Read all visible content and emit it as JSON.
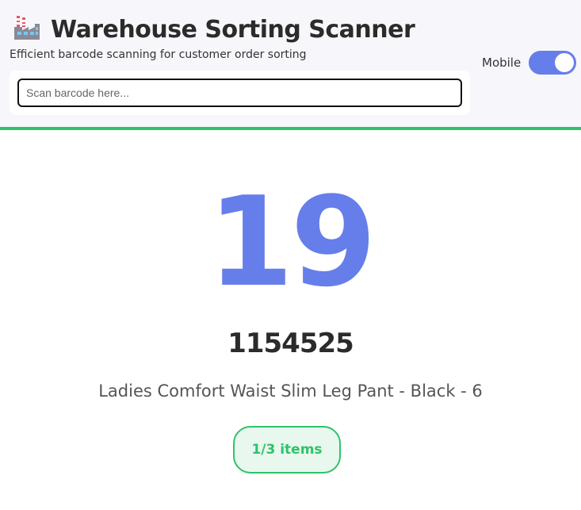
{
  "header": {
    "icon": "factory-icon",
    "title": "Warehouse Sorting Scanner",
    "subtitle": "Efficient barcode scanning for customer order sorting",
    "scan": {
      "value": "",
      "placeholder": "Scan barcode here..."
    },
    "mobile_toggle": {
      "label": "Mobile",
      "enabled": true
    }
  },
  "result": {
    "bin_number": "19",
    "order_number": "1154525",
    "product_name": "Ladies Comfort Waist Slim Leg Pant - Black - 6",
    "items_progress": "1/3 items"
  },
  "colors": {
    "accent": "#667eea",
    "success": "#2ec36a",
    "header_bg": "#f7f7fb"
  }
}
